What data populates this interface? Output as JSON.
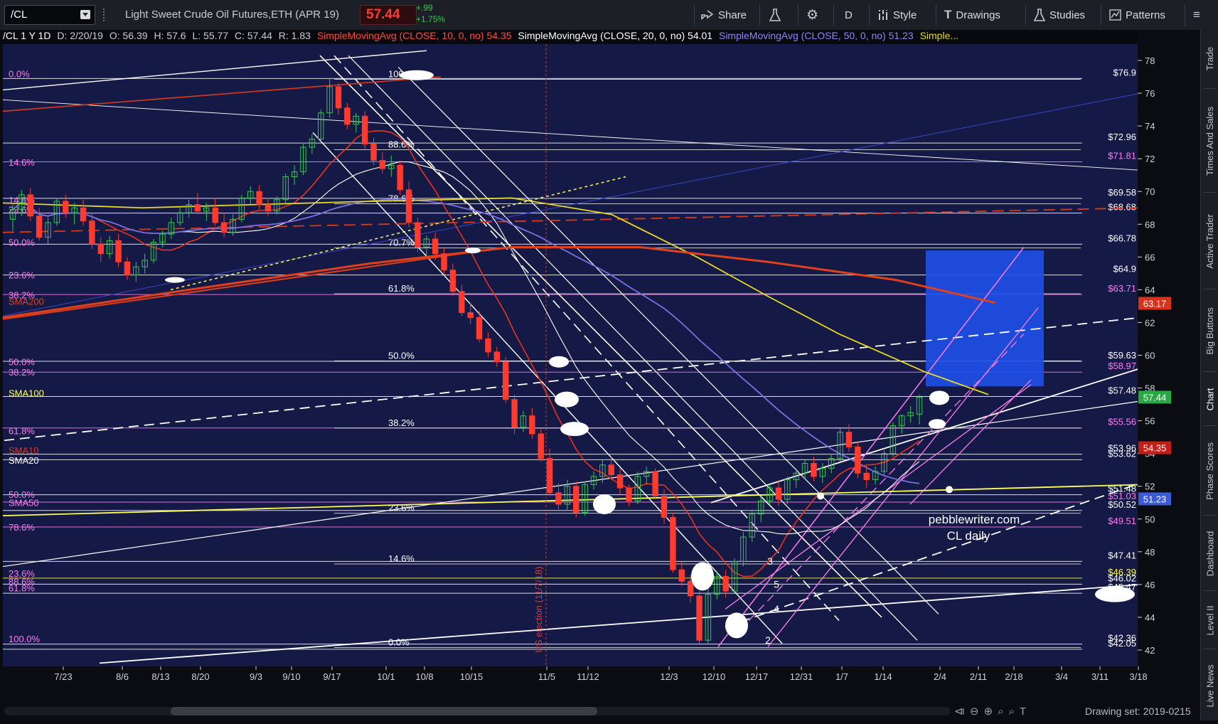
{
  "toolbar": {
    "symbol": "/CL",
    "description": "Light Sweet Crude Oil Futures,ETH (APR 19)",
    "last_price": "57.44",
    "change": "+.99",
    "change_pct": "+1.75%",
    "buttons": [
      {
        "label": "Share",
        "icon": "share-icon"
      },
      {
        "label": "",
        "icon": "flask-icon"
      },
      {
        "label": "",
        "icon": "gear-icon"
      },
      {
        "label": "D",
        "icon": ""
      },
      {
        "label": "Style",
        "icon": "style-icon"
      },
      {
        "label": "Drawings",
        "icon": "drawings-icon"
      },
      {
        "label": "Studies",
        "icon": "studies-icon"
      },
      {
        "label": "Patterns",
        "icon": "patterns-icon"
      },
      {
        "label": "",
        "icon": "menu-icon"
      }
    ]
  },
  "status": {
    "symbol_info": "/CL 1 Y 1D",
    "date": "D: 2/20/19",
    "open": "O: 56.39",
    "high": "H: 57.6",
    "low": "L: 55.77",
    "close": "C: 57.44",
    "range": "R: 1.83",
    "sma10": "SimpleMovingAvg (CLOSE, 10, 0, no)",
    "sma10_val": "54.35",
    "sma20": "SimpleMovingAvg (CLOSE, 20, 0, no)",
    "sma20_val": "54.01",
    "sma50": "SimpleMovingAvg (CLOSE, 50, 0, no)",
    "sma50_val": "51.23",
    "more": "Simple..."
  },
  "right_tabs": [
    "Trade",
    "Times And Sales",
    "Active Trader",
    "Big Buttons",
    "Chart",
    "Phase Scores",
    "Dashboard",
    "Level II",
    "Live News"
  ],
  "active_tab": "Chart",
  "watermark": [
    "pebblewriter.com",
    "CL daily"
  ],
  "election_label": "US election (11/7/18)",
  "drawing_set": "Drawing set: 2019-0215",
  "colors": {
    "background": "#141a45",
    "up": "#39c451",
    "down": "#ff3a2e",
    "sma10": "#e8321f",
    "sma20": "#ffffff",
    "sma50": "#7a70e0",
    "sma100": "#e6d629",
    "sma200": "#e0401c",
    "fib_white": "#ffffff",
    "fib_magenta": "#ff7cf0",
    "fib_yellow": "#ffff55"
  },
  "chart_data": {
    "type": "candlestick",
    "title": "/CL 1 Y 1D",
    "y_range": [
      41,
      79
    ],
    "y_ticks": [
      42,
      44,
      46,
      48,
      50,
      52,
      54,
      56,
      58,
      60,
      62,
      64,
      66,
      68,
      70,
      72,
      74,
      76,
      78
    ],
    "x_ticks": [
      "7/23",
      "8/6",
      "8/13",
      "8/20",
      "9/3",
      "9/10",
      "9/17",
      "10/1",
      "10/8",
      "10/15",
      "11/5",
      "11/12",
      "12/3",
      "12/10",
      "12/17",
      "12/31",
      "1/7",
      "1/14",
      "2/4",
      "2/11",
      "2/18",
      "3/4",
      "3/11",
      "3/18"
    ],
    "price_levels": [
      {
        "label": "$76.9",
        "value": 76.9
      },
      {
        "label": "$72.96",
        "value": 72.96
      },
      {
        "label": "$71.81",
        "value": 71.81
      },
      {
        "label": "$69.58",
        "value": 69.58
      },
      {
        "label": "$68.68",
        "value": 68.68
      },
      {
        "label": "$66.78",
        "value": 66.78
      },
      {
        "label": "$64.9",
        "value": 64.9
      },
      {
        "label": "$63.71",
        "value": 63.71
      },
      {
        "label": "$59.63",
        "value": 59.63
      },
      {
        "label": "$58.97",
        "value": 58.97
      },
      {
        "label": "$57.48",
        "value": 57.48
      },
      {
        "label": "$55.56",
        "value": 55.56
      },
      {
        "label": "$53.96",
        "value": 53.96
      },
      {
        "label": "$53.62",
        "value": 53.62
      },
      {
        "label": "$51.48",
        "value": 51.48
      },
      {
        "label": "$51.03",
        "value": 51.03
      },
      {
        "label": "$50.52",
        "value": 50.52
      },
      {
        "label": "$49.51",
        "value": 49.51
      },
      {
        "label": "$47.41",
        "value": 47.41
      },
      {
        "label": "$46.39",
        "value": 46.39
      },
      {
        "label": "$46.02",
        "value": 46.02
      },
      {
        "label": "$45.47",
        "value": 45.47
      },
      {
        "label": "$42.36",
        "value": 42.36
      },
      {
        "label": "$42.05",
        "value": 42.05
      }
    ],
    "fib_left_labels": [
      {
        "label": "0.0%",
        "value": 77.2
      },
      {
        "label": "14.6%",
        "value": 71.8
      },
      {
        "label": "14.6%",
        "value": 69.5
      },
      {
        "label": "23.6%",
        "value": 68.9
      },
      {
        "label": "50.0%",
        "value": 66.9
      },
      {
        "label": "23.6%",
        "value": 64.9
      },
      {
        "label": "38.2%",
        "value": 63.7
      },
      {
        "label": "SMA200",
        "value": 63.3
      },
      {
        "label": "50.0%",
        "value": 59.6
      },
      {
        "label": "38.2%",
        "value": 58.97
      },
      {
        "label": "SMA100",
        "value": 57.7
      },
      {
        "label": "61.8%",
        "value": 55.4
      },
      {
        "label": "SMA10",
        "value": 54.2
      },
      {
        "label": "SMA20",
        "value": 53.6
      },
      {
        "label": "50.0%",
        "value": 51.5
      },
      {
        "label": "SMA50",
        "value": 51.0
      },
      {
        "label": "78.6%",
        "value": 49.51
      },
      {
        "label": "23.6%",
        "value": 46.7
      },
      {
        "label": "88.6%",
        "value": 46.2
      },
      {
        "label": "61.8%",
        "value": 45.8
      },
      {
        "label": "100.0%",
        "value": 42.7
      }
    ],
    "fib_mid_labels": [
      {
        "label": "100.0%",
        "value": 77.2
      },
      {
        "label": "88.6%",
        "value": 72.9
      },
      {
        "label": "78.6%",
        "value": 69.6
      },
      {
        "label": "70.7%",
        "value": 66.9
      },
      {
        "label": "61.8%",
        "value": 64.1
      },
      {
        "label": "50.0%",
        "value": 60.0
      },
      {
        "label": "38.2%",
        "value": 55.9
      },
      {
        "label": "23.6%",
        "value": 50.7
      },
      {
        "label": "14.6%",
        "value": 47.6
      },
      {
        "label": "0.0%",
        "value": 42.5
      }
    ],
    "markers": [
      {
        "price": "63.17",
        "label": "63.17",
        "color": "#d7321d"
      },
      {
        "price": "57.44",
        "label": "57.44",
        "color": "#27a843"
      },
      {
        "price": "54.35",
        "label": "54.35",
        "color": "#c41c16"
      },
      {
        "price": "51.23",
        "label": "51.23",
        "color": "#3b5bd6"
      }
    ],
    "wave_labels": [
      "3",
      "5",
      "4",
      "2"
    ],
    "series": [
      {
        "name": "/CL",
        "ohlc": [
          [
            68.3,
            69.2,
            67.6,
            68.9
          ],
          [
            68.9,
            70.1,
            68.5,
            69.8
          ],
          [
            69.8,
            70.2,
            68.2,
            68.5
          ],
          [
            68.5,
            69.0,
            67.0,
            67.2
          ],
          [
            67.2,
            68.4,
            66.8,
            68.1
          ],
          [
            68.1,
            69.6,
            67.9,
            69.4
          ],
          [
            69.4,
            69.8,
            68.4,
            68.7
          ],
          [
            68.7,
            69.3,
            68.0,
            69.0
          ],
          [
            69.0,
            69.5,
            67.9,
            68.2
          ],
          [
            68.2,
            68.7,
            66.5,
            66.8
          ],
          [
            66.8,
            67.2,
            65.7,
            66.2
          ],
          [
            66.2,
            67.3,
            65.9,
            67.0
          ],
          [
            67.0,
            67.4,
            65.4,
            65.7
          ],
          [
            65.7,
            66.0,
            64.6,
            64.9
          ],
          [
            64.9,
            65.7,
            64.5,
            65.4
          ],
          [
            65.4,
            66.2,
            65.0,
            65.8
          ],
          [
            65.8,
            67.1,
            65.6,
            66.9
          ],
          [
            66.9,
            67.6,
            66.6,
            67.4
          ],
          [
            67.4,
            68.4,
            67.1,
            68.1
          ],
          [
            68.1,
            69.0,
            67.9,
            68.7
          ],
          [
            68.7,
            69.5,
            68.4,
            69.2
          ],
          [
            69.2,
            69.9,
            68.6,
            68.8
          ],
          [
            68.8,
            69.3,
            68.2,
            69.0
          ],
          [
            69.0,
            69.6,
            67.9,
            68.1
          ],
          [
            68.1,
            68.7,
            67.2,
            67.5
          ],
          [
            67.5,
            68.6,
            67.3,
            68.3
          ],
          [
            68.3,
            69.8,
            68.1,
            69.6
          ],
          [
            69.6,
            70.3,
            69.2,
            70.0
          ],
          [
            70.0,
            70.4,
            68.9,
            69.2
          ],
          [
            69.2,
            69.6,
            68.5,
            68.8
          ],
          [
            68.8,
            69.7,
            68.6,
            69.5
          ],
          [
            69.5,
            71.1,
            69.3,
            70.9
          ],
          [
            70.9,
            71.6,
            70.4,
            71.2
          ],
          [
            71.2,
            72.9,
            71.0,
            72.7
          ],
          [
            72.7,
            73.5,
            72.3,
            73.2
          ],
          [
            73.2,
            75.0,
            73.0,
            74.8
          ],
          [
            74.8,
            76.9,
            74.5,
            76.4
          ],
          [
            76.4,
            76.6,
            74.7,
            75.1
          ],
          [
            75.1,
            75.4,
            73.8,
            74.1
          ],
          [
            74.1,
            74.8,
            73.6,
            74.6
          ],
          [
            74.6,
            74.9,
            72.6,
            72.9
          ],
          [
            72.9,
            73.3,
            71.6,
            71.9
          ],
          [
            71.9,
            72.4,
            71.1,
            71.4
          ],
          [
            71.4,
            72.2,
            70.9,
            71.6
          ],
          [
            71.6,
            71.9,
            69.8,
            70.1
          ],
          [
            70.1,
            70.6,
            67.8,
            68.1
          ],
          [
            68.1,
            68.4,
            66.3,
            66.6
          ],
          [
            66.6,
            67.3,
            66.0,
            67.1
          ],
          [
            67.1,
            67.5,
            65.8,
            66.2
          ],
          [
            66.2,
            66.6,
            64.9,
            65.2
          ],
          [
            65.2,
            65.6,
            63.6,
            63.9
          ],
          [
            63.9,
            64.3,
            62.4,
            62.6
          ],
          [
            62.6,
            63.2,
            61.9,
            62.3
          ],
          [
            62.3,
            62.7,
            60.8,
            61.0
          ],
          [
            61.0,
            61.4,
            59.9,
            60.2
          ],
          [
            60.2,
            60.5,
            59.3,
            59.6
          ],
          [
            59.6,
            59.9,
            57.1,
            57.3
          ],
          [
            57.3,
            57.6,
            55.2,
            55.6
          ],
          [
            55.6,
            56.6,
            55.3,
            56.3
          ],
          [
            56.3,
            56.8,
            54.9,
            55.2
          ],
          [
            55.2,
            55.5,
            53.5,
            53.7
          ],
          [
            53.7,
            54.3,
            51.4,
            51.6
          ],
          [
            51.6,
            52.2,
            50.6,
            50.9
          ],
          [
            50.9,
            52.4,
            50.5,
            52.0
          ],
          [
            52.0,
            52.3,
            50.1,
            50.4
          ],
          [
            50.4,
            52.3,
            50.2,
            52.1
          ],
          [
            52.1,
            52.9,
            51.8,
            52.6
          ],
          [
            52.6,
            53.6,
            52.2,
            53.3
          ],
          [
            53.3,
            53.8,
            52.4,
            52.7
          ],
          [
            52.7,
            53.1,
            51.5,
            51.9
          ],
          [
            51.9,
            52.1,
            50.8,
            51.1
          ],
          [
            51.1,
            52.9,
            50.9,
            52.6
          ],
          [
            52.6,
            53.2,
            52.1,
            52.9
          ],
          [
            52.9,
            53.1,
            51.2,
            51.4
          ],
          [
            51.4,
            51.8,
            49.7,
            50.1
          ],
          [
            50.1,
            50.4,
            46.7,
            46.9
          ],
          [
            46.9,
            47.4,
            45.9,
            46.2
          ],
          [
            46.2,
            46.6,
            44.9,
            45.3
          ],
          [
            45.3,
            45.6,
            42.4,
            42.6
          ],
          [
            42.6,
            45.9,
            42.4,
            45.4
          ],
          [
            45.4,
            46.8,
            45.1,
            46.5
          ],
          [
            46.5,
            46.9,
            45.2,
            45.6
          ],
          [
            45.6,
            47.6,
            45.4,
            47.4
          ],
          [
            47.4,
            49.2,
            47.1,
            48.9
          ],
          [
            48.9,
            50.5,
            48.6,
            50.3
          ],
          [
            50.3,
            51.4,
            49.8,
            51.1
          ],
          [
            51.1,
            52.2,
            50.9,
            51.9
          ],
          [
            51.9,
            52.3,
            50.8,
            51.2
          ],
          [
            51.2,
            52.6,
            50.9,
            52.4
          ],
          [
            52.4,
            53.1,
            51.9,
            52.8
          ],
          [
            52.8,
            53.6,
            52.4,
            53.4
          ],
          [
            53.4,
            53.8,
            52.3,
            52.6
          ],
          [
            52.6,
            53.4,
            52.2,
            53.1
          ],
          [
            53.1,
            54.0,
            52.8,
            53.7
          ],
          [
            53.7,
            55.6,
            53.5,
            55.3
          ],
          [
            55.3,
            55.8,
            54.1,
            54.4
          ],
          [
            54.4,
            54.7,
            52.5,
            52.8
          ],
          [
            52.8,
            53.3,
            51.9,
            52.4
          ],
          [
            52.4,
            53.2,
            52.1,
            52.9
          ],
          [
            52.9,
            54.2,
            52.7,
            54.0
          ],
          [
            54.0,
            55.9,
            53.8,
            55.7
          ],
          [
            55.7,
            56.4,
            55.2,
            56.3
          ],
          [
            56.3,
            56.9,
            55.9,
            56.5
          ],
          [
            56.39,
            57.6,
            55.77,
            57.44
          ]
        ]
      }
    ],
    "sma_series": [
      {
        "name": "SMA10",
        "last": 54.35
      },
      {
        "name": "SMA20",
        "last": 54.01
      },
      {
        "name": "SMA50",
        "last": 51.23
      },
      {
        "name": "SMA100",
        "last": 57.6
      },
      {
        "name": "SMA200",
        "last": 63.17
      }
    ]
  }
}
